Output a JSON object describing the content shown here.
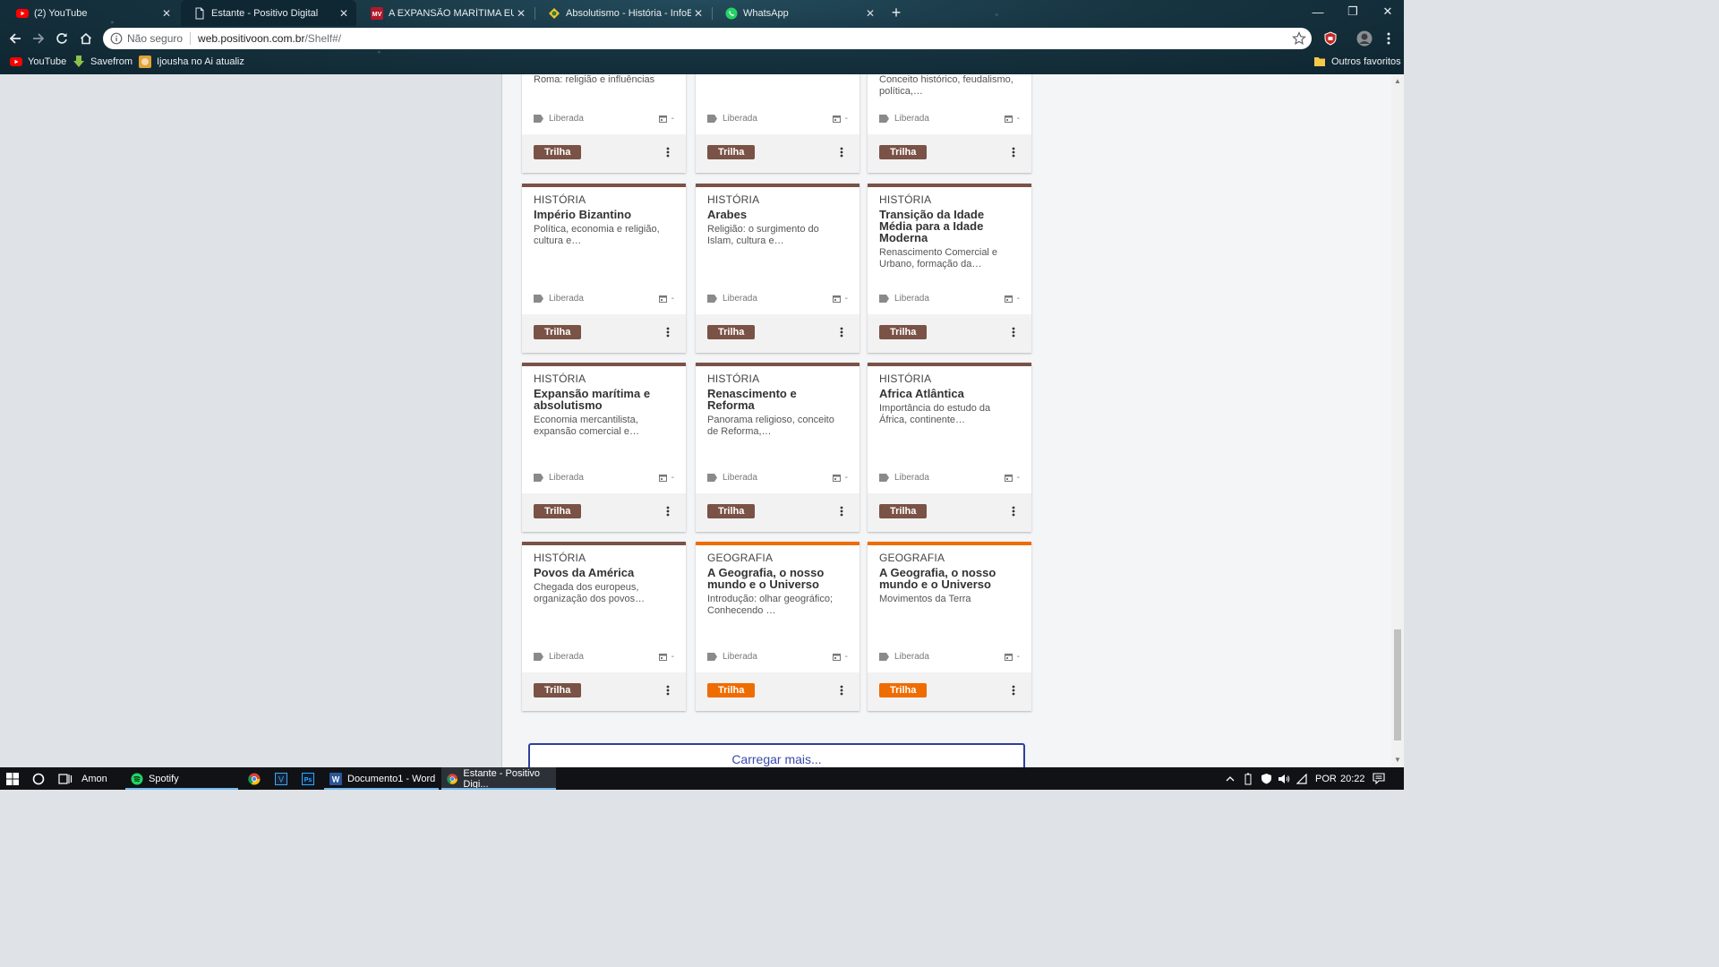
{
  "browser": {
    "tabs": [
      {
        "title": "(2) YouTube",
        "icon": "youtube-icon"
      },
      {
        "title": "Estante - Positivo Digital",
        "icon": "page-icon",
        "active": true
      },
      {
        "title": "A EXPANSÃO MARÍTIMA EUROP",
        "icon": "mv-icon"
      },
      {
        "title": "Absolutismo - História - InfoEsc",
        "icon": "infoescola-icon"
      },
      {
        "title": "WhatsApp",
        "icon": "whatsapp-icon"
      }
    ],
    "omnibox": {
      "security_label": "Não seguro",
      "url_domain": "web.positivoon.com.br",
      "url_path": "/Shelf#/"
    },
    "bookmarks": [
      {
        "label": "YouTube",
        "icon": "youtube-icon"
      },
      {
        "label": "Savefrom",
        "icon": "download-arrow-icon"
      },
      {
        "label": "Ijousha no Ai atualiz",
        "icon": "anime-icon"
      }
    ],
    "other_bookmarks": "Outros favoritos"
  },
  "colors": {
    "historia": "#7a5246",
    "geografia": "#ef6c00",
    "load_more_border": "#2f3f9e"
  },
  "top_row": [
    {
      "desc": "Roma: religião e influências",
      "status": "Liberada",
      "date": "-",
      "action": "Trilha",
      "color": "historia"
    },
    {
      "desc": "",
      "status": "Liberada",
      "date": "-",
      "action": "Trilha",
      "color": "historia"
    },
    {
      "desc": "Conceito histórico, feudalismo, política,…",
      "status": "Liberada",
      "date": "-",
      "action": "Trilha",
      "color": "historia"
    }
  ],
  "cards": [
    {
      "subject": "HISTÓRIA",
      "title": "Império Bizantino",
      "desc": "Política, economia e religião, cultura e…",
      "status": "Liberada",
      "date": "-",
      "action": "Trilha",
      "color": "historia"
    },
    {
      "subject": "HISTÓRIA",
      "title": "Arabes",
      "desc": "Religião: o surgimento do Islam, cultura e…",
      "status": "Liberada",
      "date": "-",
      "action": "Trilha",
      "color": "historia"
    },
    {
      "subject": "HISTÓRIA",
      "title": "Transição da Idade Média para a Idade Moderna",
      "desc": "Renascimento Comercial e Urbano, formação da…",
      "status": "Liberada",
      "date": "-",
      "action": "Trilha",
      "color": "historia"
    },
    {
      "subject": "HISTÓRIA",
      "title": "Expansão marítima e absolutismo",
      "desc": "Economia mercantilista, expansão comercial e…",
      "status": "Liberada",
      "date": "-",
      "action": "Trilha",
      "color": "historia"
    },
    {
      "subject": "HISTÓRIA",
      "title": "Renascimento e Reforma",
      "desc": "Panorama religioso, conceito de Reforma,…",
      "status": "Liberada",
      "date": "-",
      "action": "Trilha",
      "color": "historia"
    },
    {
      "subject": "HISTÓRIA",
      "title": "Africa Atlântica",
      "desc": "Importância do estudo da África, continente…",
      "status": "Liberada",
      "date": "-",
      "action": "Trilha",
      "color": "historia"
    },
    {
      "subject": "HISTÓRIA",
      "title": "Povos da América",
      "desc": "Chegada dos europeus, organização dos povos…",
      "status": "Liberada",
      "date": "-",
      "action": "Trilha",
      "color": "historia"
    },
    {
      "subject": "GEOGRAFIA",
      "title": "A Geografia, o nosso mundo e o Universo",
      "desc": "Introdução: olhar geográfico; Conhecendo …",
      "status": "Liberada",
      "date": "-",
      "action": "Trilha",
      "color": "geografia"
    },
    {
      "subject": "GEOGRAFIA",
      "title": "A Geografia, o nosso mundo e o Universo",
      "desc": "Movimentos da Terra",
      "status": "Liberada",
      "date": "-",
      "action": "Trilha",
      "color": "geografia"
    }
  ],
  "load_more": "Carregar mais...",
  "taskbar": {
    "search_user": "Amon",
    "apps": [
      {
        "label": "Spotify",
        "icon": "spotify-icon"
      },
      {
        "label": "Documento1 - Word",
        "icon": "word-icon"
      },
      {
        "label": "Estante - Positivo Digi...",
        "icon": "chrome-icon"
      }
    ],
    "language": "POR",
    "time": "20:22"
  }
}
